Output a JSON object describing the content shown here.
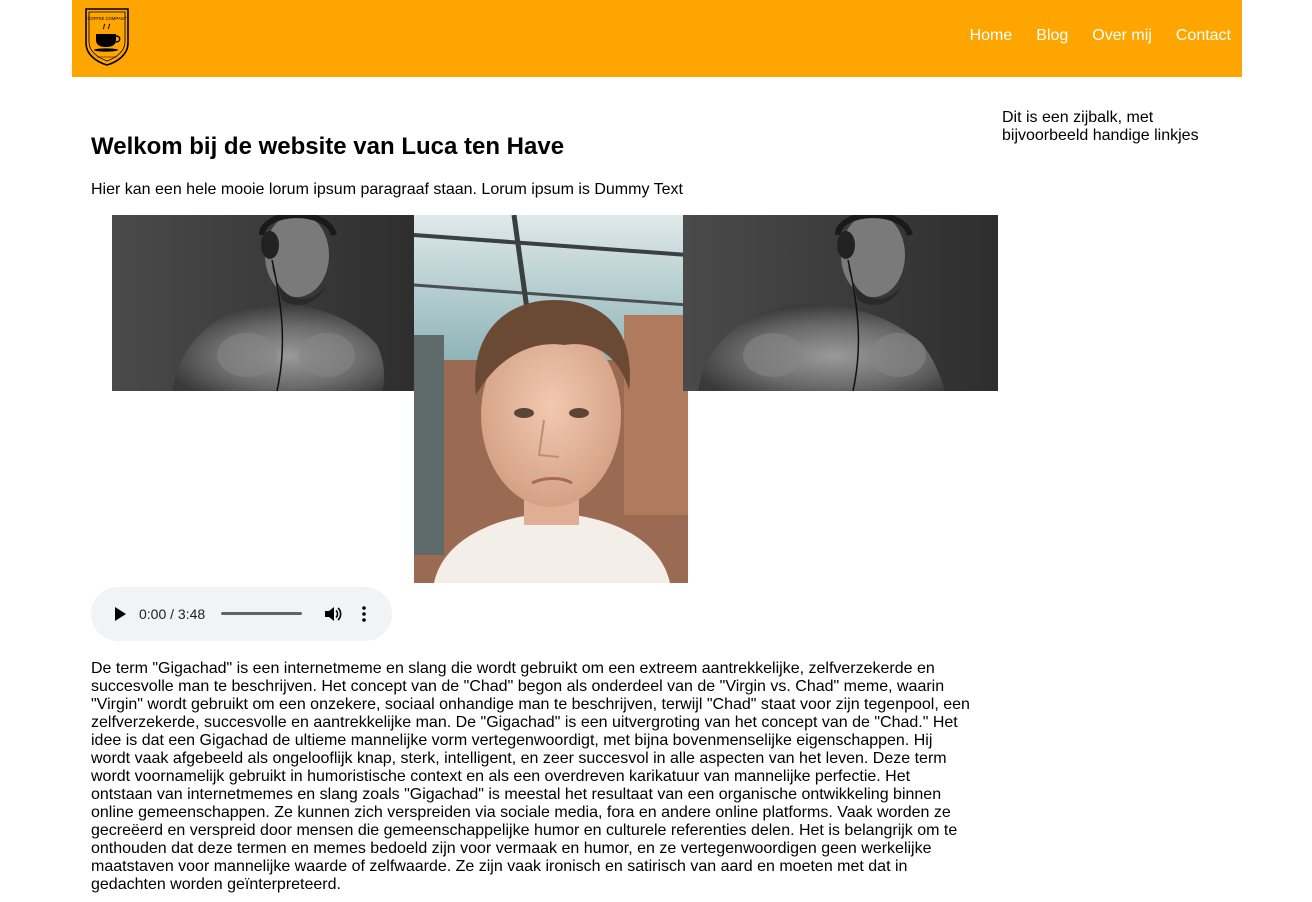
{
  "header": {
    "logo_alt": "Coffee Company logo",
    "logo_text": "COFFEE COMPANY",
    "nav": [
      {
        "label": "Home"
      },
      {
        "label": "Blog"
      },
      {
        "label": "Over mij"
      },
      {
        "label": "Contact"
      }
    ]
  },
  "sidebar": {
    "text": "Dit is een zijbalk, met bijvoorbeeld handige linkjes"
  },
  "main": {
    "title": "Welkom bij de website van Luca ten Have",
    "intro": "Hier kan een hele mooie lorum ipsum paragraaf staan. Lorum ipsum is Dummy Text",
    "images": [
      {
        "name": "gigachad-image-left",
        "alt": "Gigachad meme"
      },
      {
        "name": "selfie-image",
        "alt": "Luca ten Have"
      },
      {
        "name": "gigachad-image-right",
        "alt": "Gigachad meme"
      }
    ],
    "audio": {
      "time": "0:00 / 3:48"
    },
    "body": "De term \"Gigachad\" is een internetmeme en slang die wordt gebruikt om een extreem aantrekkelijke, zelfverzekerde en succesvolle man te beschrijven. Het concept van de \"Chad\" begon als onderdeel van de \"Virgin vs. Chad\" meme, waarin \"Virgin\" wordt gebruikt om een onzekere, sociaal onhandige man te beschrijven, terwijl \"Chad\" staat voor zijn tegenpool, een zelfverzekerde, succesvolle en aantrekkelijke man. De \"Gigachad\" is een uitvergroting van het concept van de \"Chad.\" Het idee is dat een Gigachad de ultieme mannelijke vorm vertegenwoordigt, met bijna bovenmenselijke eigenschappen. Hij wordt vaak afgebeeld als ongelooflijk knap, sterk, intelligent, en zeer succesvol in alle aspecten van het leven. Deze term wordt voornamelijk gebruikt in humoristische context en als een overdreven karikatuur van mannelijke perfectie. Het ontstaan van internetmemes en slang zoals \"Gigachad\" is meestal het resultaat van een organische ontwikkeling binnen online gemeenschappen. Ze kunnen zich verspreiden via sociale media, fora en andere online platforms. Vaak worden ze gecreëerd en verspreid door mensen die gemeenschappelijke humor en culturele referenties delen. Het is belangrijk om te onthouden dat deze termen en memes bedoeld zijn voor vermaak en humor, en ze vertegenwoordigen geen werkelijke maatstaven voor mannelijke waarde of zelfwaarde. Ze zijn vaak ironisch en satirisch van aard en moeten met dat in gedachten worden geïnterpreteerd."
  },
  "colors": {
    "header_bg": "#ffa500",
    "nav_text": "#ffffff",
    "audio_bg": "#f1f3f4"
  }
}
